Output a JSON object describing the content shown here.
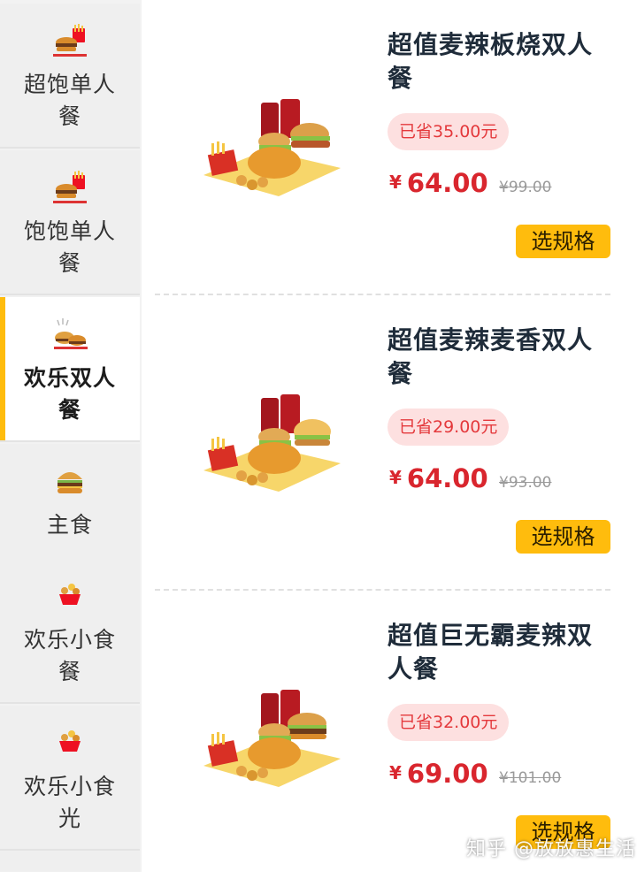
{
  "sidebar": {
    "categories": [
      {
        "label": "超饱单人餐",
        "icon": "meal-set-icon"
      },
      {
        "label": "饱饱单人餐",
        "icon": "meal-set-icon"
      },
      {
        "label": "欢乐双人餐",
        "icon": "double-meal-icon",
        "active": true
      },
      {
        "label": "主食",
        "icon": "burger-icon"
      },
      {
        "label": "欢乐小食餐",
        "icon": "snack-bowl-icon"
      },
      {
        "label": "欢乐小食光",
        "icon": "snack-bowl-icon"
      }
    ]
  },
  "products": [
    {
      "title": "超值麦辣板烧双人餐",
      "saved": "已省35.00元",
      "currency": "¥",
      "price": "64.00",
      "original": "¥99.00",
      "button": "选规格"
    },
    {
      "title": "超值麦辣麦香双人餐",
      "saved": "已省29.00元",
      "currency": "¥",
      "price": "64.00",
      "original": "¥93.00",
      "button": "选规格"
    },
    {
      "title": "超值巨无霸麦辣双人餐",
      "saved": "已省32.00元",
      "currency": "¥",
      "price": "69.00",
      "original": "¥101.00",
      "button": "选规格"
    }
  ],
  "watermark": "知乎 @放放惠生活",
  "colors": {
    "accent": "#ffbc0d",
    "price": "#d9262e",
    "save_bg": "#fde0e0"
  }
}
